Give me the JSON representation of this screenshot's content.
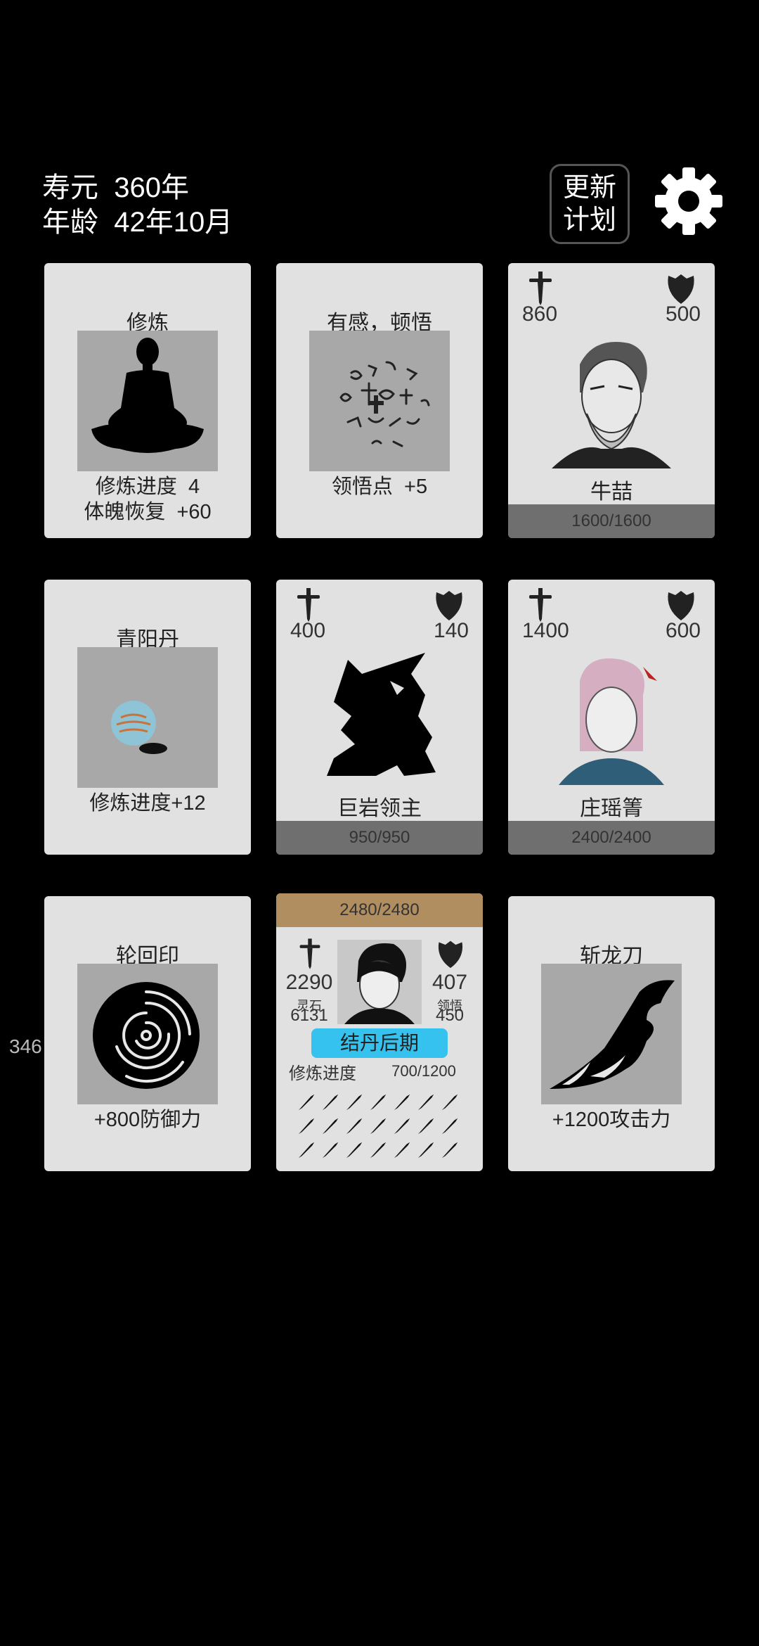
{
  "status": {
    "lifespan": "寿元  360年",
    "age": "年龄  42年10月"
  },
  "update_button": {
    "line1": "更新",
    "line2": "计划"
  },
  "side_value": "346",
  "cards": {
    "cultivate": {
      "title": "修炼",
      "line1": "修炼进度  4",
      "line2": "体魄恢复  +60"
    },
    "insight": {
      "title": "有感，顿悟",
      "line1": "领悟点  +5"
    },
    "enemy1": {
      "attack": "860",
      "defense": "500",
      "name": "牛喆",
      "hp": "1600/1600"
    },
    "pill": {
      "title": "青阳丹",
      "line1": "修炼进度+12"
    },
    "enemy2": {
      "attack": "400",
      "defense": "140",
      "name": "巨岩领主",
      "hp": "950/950"
    },
    "enemy3": {
      "attack": "1400",
      "defense": "600",
      "name": "庄瑶箐",
      "hp": "2400/2400"
    },
    "seal": {
      "title": "轮回印",
      "line1": "+800防御力"
    },
    "player": {
      "hp": "2480/2480",
      "attack": "2290",
      "defense": "407",
      "spirit_stone_label": "灵石",
      "spirit_stone": "6131",
      "insight_label": "领悟",
      "insight": "450",
      "realm": "结丹后期",
      "progress_label": "修炼进度",
      "progress": "700/1200"
    },
    "sword": {
      "title": "斩龙刀",
      "line1": "+1200攻击力"
    }
  },
  "icons": {
    "attack": "sword-icon",
    "defense": "shield-icon",
    "settings": "gear-icon"
  },
  "colors": {
    "background": "#000000",
    "card": "#e1e1e1",
    "enemy_hp_bar": "#6f6f6f",
    "player_hp_bar": "#b08e5f",
    "realm_badge": "#36c2ef"
  }
}
